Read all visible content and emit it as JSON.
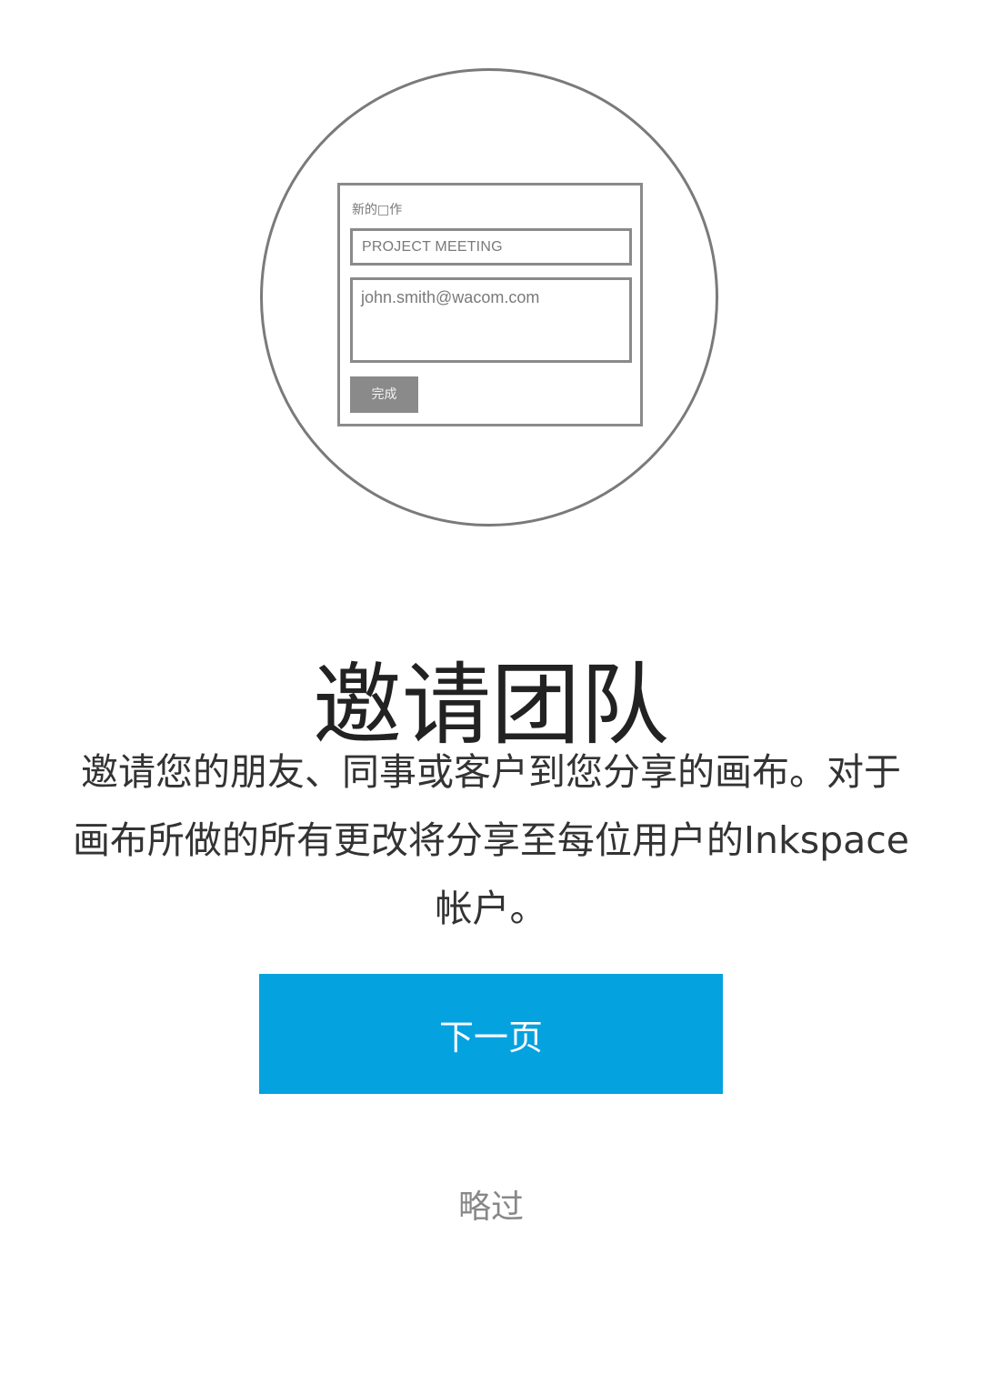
{
  "illustration": {
    "heading": "新的□作",
    "project_input_value": "PROJECT MEETING",
    "email_textarea_value": "john.smith@wacom.com",
    "done_button_label": "完成"
  },
  "title": "邀请团队",
  "description": "邀请您的朋友、同事或客户到您分享的画布。对于画布所做的所有更改将分享至每位用户的Inkspace帐户。",
  "next_button_label": "下一页",
  "skip_label": "略过",
  "colors": {
    "primary_button": "#05a2e0",
    "illustration_stroke": "#7a7a7a",
    "skip_text": "#888888"
  }
}
